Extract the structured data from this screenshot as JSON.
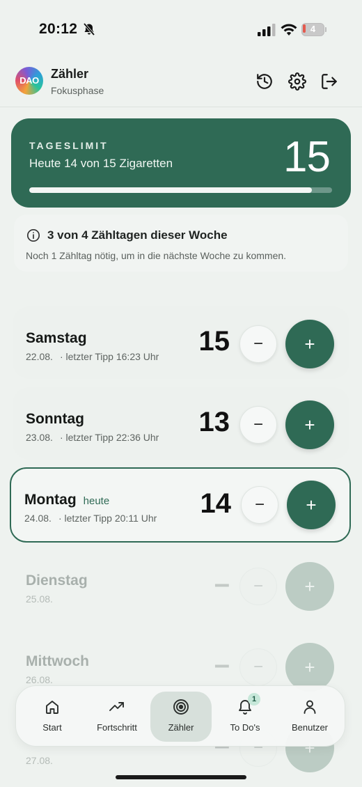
{
  "status_bar": {
    "time": "20:12",
    "battery": "4"
  },
  "header": {
    "title": "Zähler",
    "subtitle": "Fokusphase",
    "logo_text": "DAO"
  },
  "limit": {
    "label": "TAGESLIMIT",
    "text": "Heute 14 von 15 Zigaretten",
    "number": "15",
    "progress": 0.9333
  },
  "info": {
    "title": "3 von 4 Zähltagen dieser Woche",
    "text": "Noch 1 Zähltag nötig, um in die nächste Woche zu kommen."
  },
  "days": [
    {
      "name": "Samstag",
      "date": "22.08.",
      "last": "· letzter Tipp 16:23 Uhr",
      "count": "15",
      "tag": ""
    },
    {
      "name": "Sonntag",
      "date": "23.08.",
      "last": "· letzter Tipp 22:36 Uhr",
      "count": "13",
      "tag": ""
    },
    {
      "name": "Montag",
      "date": "24.08.",
      "last": "· letzter Tipp 20:11 Uhr",
      "count": "14",
      "tag": "heute"
    },
    {
      "name": "Dienstag",
      "date": "25.08.",
      "last": "",
      "count": "–",
      "tag": ""
    },
    {
      "name": "Mittwoch",
      "date": "26.08.",
      "last": "",
      "count": "–",
      "tag": ""
    },
    {
      "name": "",
      "date": "27.08.",
      "last": "",
      "count": "–",
      "tag": ""
    }
  ],
  "buttons": {
    "minus": "−",
    "plus": "+"
  },
  "nav": {
    "items": [
      {
        "label": "Start",
        "icon": "home-icon"
      },
      {
        "label": "Fortschritt",
        "icon": "trending-up-icon"
      },
      {
        "label": "Zähler",
        "icon": "target-icon"
      },
      {
        "label": "To Do's",
        "icon": "bell-icon",
        "badge": "1"
      },
      {
        "label": "Benutzer",
        "icon": "user-icon"
      }
    ],
    "active": "Zähler"
  },
  "colors": {
    "accent": "#2f6a55",
    "background": "#eef2ef",
    "disabled": "#bcccc4"
  }
}
